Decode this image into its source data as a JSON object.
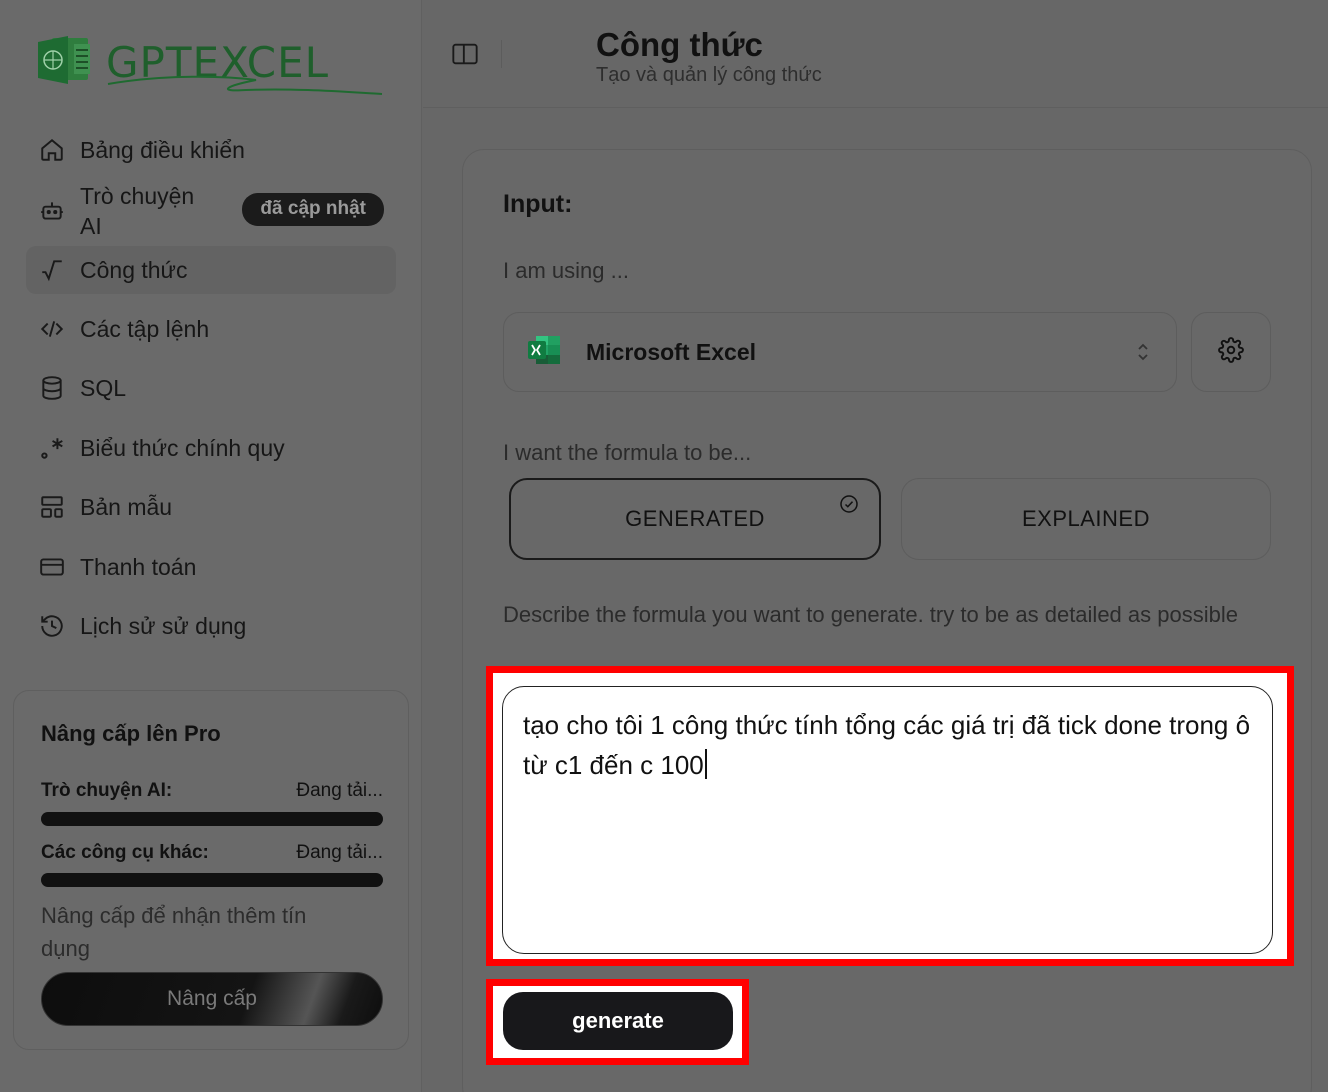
{
  "brand": {
    "name": "GPTEXCEL"
  },
  "sidebar": {
    "items": [
      {
        "label": "Bảng điều khiển",
        "icon": "home-icon"
      },
      {
        "label": "Trò chuyện AI",
        "icon": "robot-icon",
        "badge": "đã cập nhật"
      },
      {
        "label": "Công thức",
        "icon": "sqrt-icon",
        "active": true
      },
      {
        "label": "Các tập lệnh",
        "icon": "code-icon"
      },
      {
        "label": "SQL",
        "icon": "database-icon"
      },
      {
        "label": "Biểu thức chính quy",
        "icon": "regex-icon"
      },
      {
        "label": "Bản mẫu",
        "icon": "template-icon"
      },
      {
        "label": "Thanh toán",
        "icon": "credit-card-icon"
      },
      {
        "label": "Lịch sử sử dụng",
        "icon": "history-icon"
      }
    ],
    "upgrade": {
      "title": "Nâng cấp lên Pro",
      "chat_label": "Trò chuyện AI:",
      "chat_status": "Đang tải...",
      "tools_label": "Các công cụ khác:",
      "tools_status": "Đang tải...",
      "description": "Nâng cấp để nhận thêm tín dụng",
      "button": "Nâng cấp"
    }
  },
  "header": {
    "title": "Công thức",
    "subtitle": "Tạo và quản lý công thức"
  },
  "form": {
    "input_title": "Input:",
    "using_label": "I am using ...",
    "selected_app": "Microsoft Excel",
    "mode_label": "I want the formula to be...",
    "modes": [
      {
        "label": "GENERATED",
        "selected": true
      },
      {
        "label": "EXPLAINED",
        "selected": false
      }
    ],
    "describe_label": "Describe the formula you want to generate. try to be as detailed as possible",
    "textarea_value": "tạo cho tôi 1 công thức tính tổng các giá trị đã tick done trong ô từ c1 đến c 100",
    "generate_button": "generate"
  },
  "colors": {
    "highlight": "#ff0000",
    "excel_green": "#1f7a3a",
    "button_dark": "#18181b"
  }
}
